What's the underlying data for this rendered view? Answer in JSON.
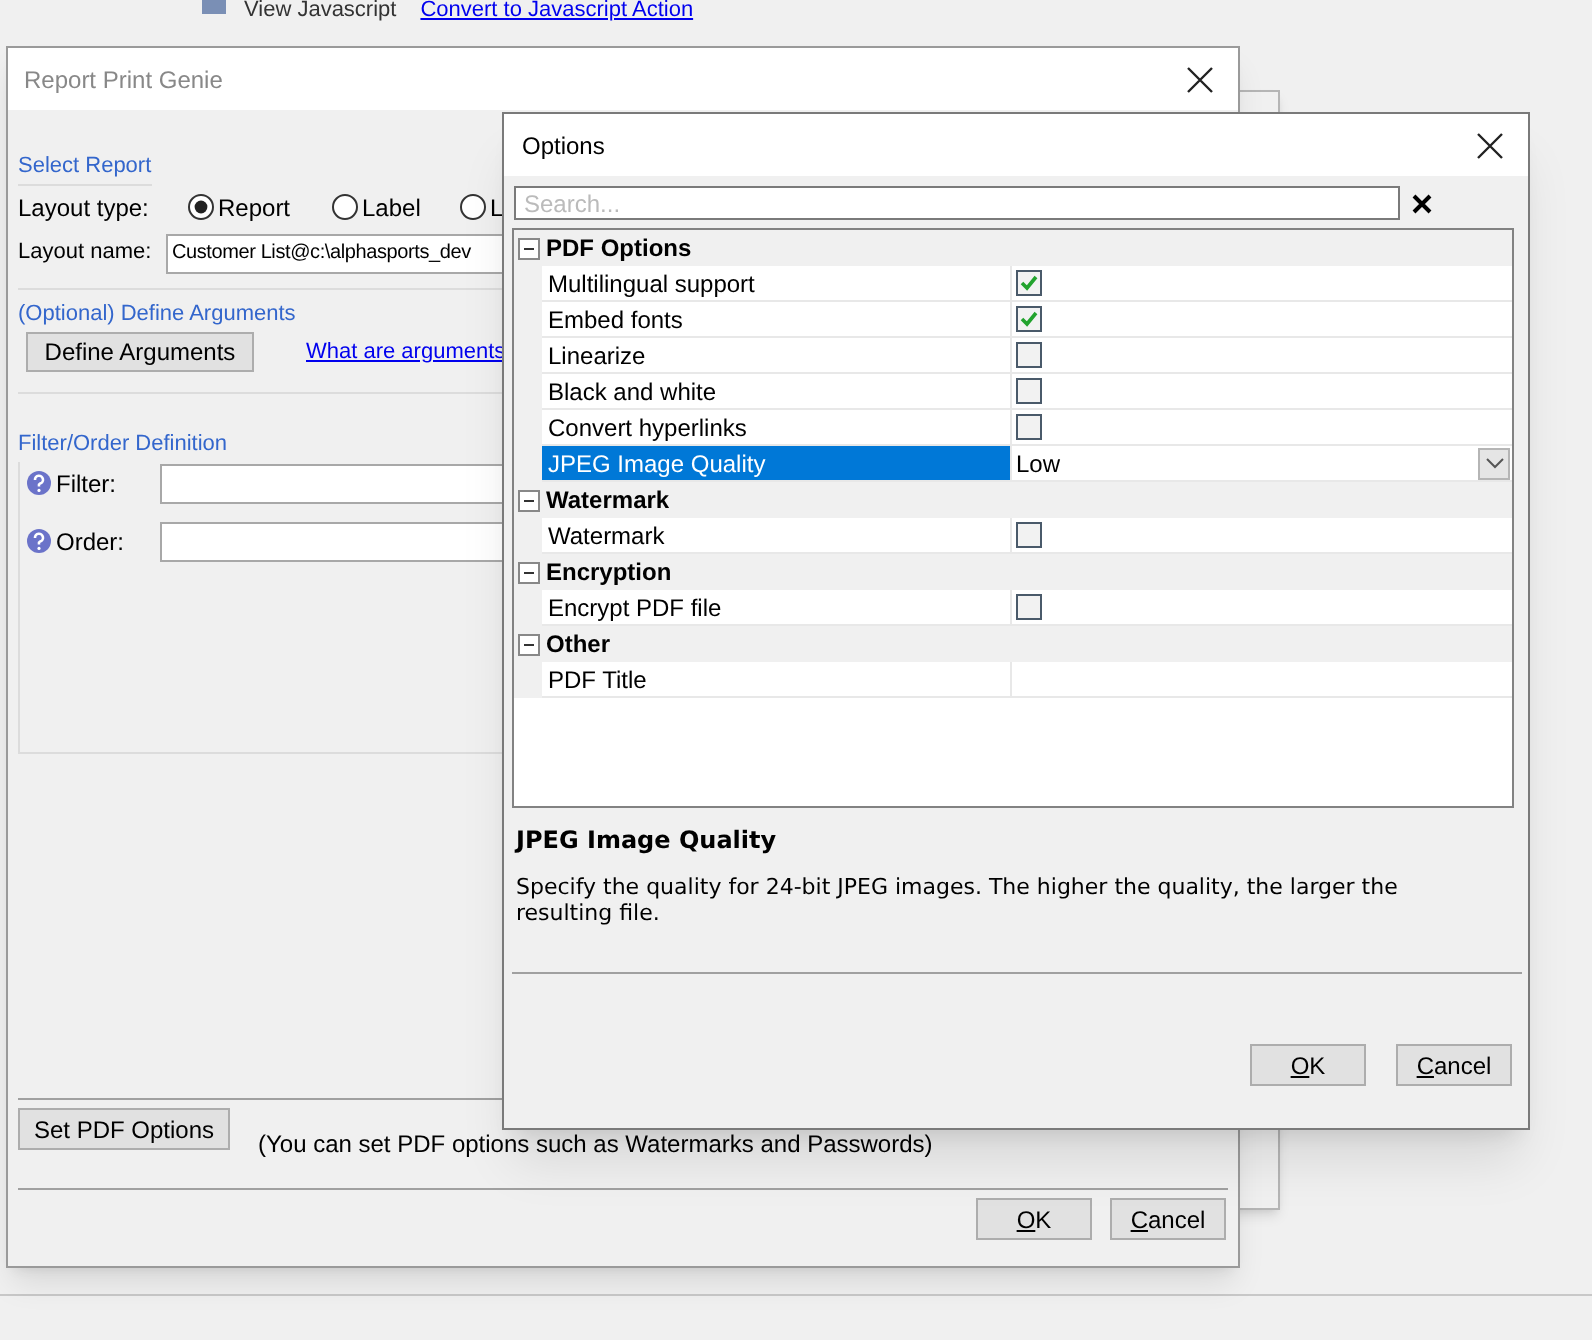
{
  "background": {
    "action_label": "View Javascript",
    "link": "Convert to Javascript Action"
  },
  "report_window": {
    "title": "Report Print Genie",
    "select_report": {
      "label": "Select Report",
      "layout_type_label": "Layout type:",
      "radios": [
        {
          "label": "Report",
          "selected": true
        },
        {
          "label": "Label",
          "selected": false
        },
        {
          "label": "L",
          "selected": false
        }
      ],
      "layout_name_label": "Layout name:",
      "layout_name_value": "Customer List@c:\\alphasports_dev"
    },
    "arguments": {
      "label": "(Optional) Define Arguments",
      "button": "Define Arguments",
      "link": "What are arguments"
    },
    "filter_order": {
      "label": "Filter/Order Definition",
      "fields": [
        {
          "label": "Filter:"
        },
        {
          "label": "Order:"
        }
      ]
    },
    "pdf": {
      "button": "Set PDF Options",
      "note": "(You can set PDF options such as Watermarks and Passwords)"
    },
    "buttons": [
      "OK",
      "Cancel"
    ]
  },
  "options_dialog": {
    "title": "Options",
    "search": {
      "placeholder": "Search..."
    },
    "groups": [
      {
        "name": "PDF Options",
        "expanded": true,
        "properties": [
          {
            "label": "Multilingual support",
            "kind": "checkbox",
            "checked": true,
            "selected": false
          },
          {
            "label": "Embed fonts",
            "kind": "checkbox",
            "checked": true,
            "selected": false
          },
          {
            "label": "Linearize",
            "kind": "checkbox",
            "checked": false,
            "selected": false
          },
          {
            "label": "Black and white",
            "kind": "checkbox",
            "checked": false,
            "selected": false
          },
          {
            "label": "Convert hyperlinks",
            "kind": "checkbox",
            "checked": false,
            "selected": false
          },
          {
            "label": "JPEG Image Quality",
            "kind": "dropdown",
            "value": "Low",
            "selected": true
          }
        ]
      },
      {
        "name": "Watermark",
        "expanded": true,
        "properties": [
          {
            "label": "Watermark",
            "kind": "checkbox",
            "checked": false,
            "selected": false
          }
        ]
      },
      {
        "name": "Encryption",
        "expanded": true,
        "properties": [
          {
            "label": "Encrypt PDF file",
            "kind": "checkbox",
            "checked": false,
            "selected": false
          }
        ]
      },
      {
        "name": "Other",
        "expanded": true,
        "properties": [
          {
            "label": "PDF Title",
            "kind": "text",
            "selected": false
          }
        ]
      }
    ],
    "description": {
      "title": "JPEG Image Quality",
      "text": "Specify the quality for 24-bit JPEG images. The higher the quality, the larger the resulting file."
    },
    "buttons": [
      "OK",
      "Cancel"
    ]
  }
}
